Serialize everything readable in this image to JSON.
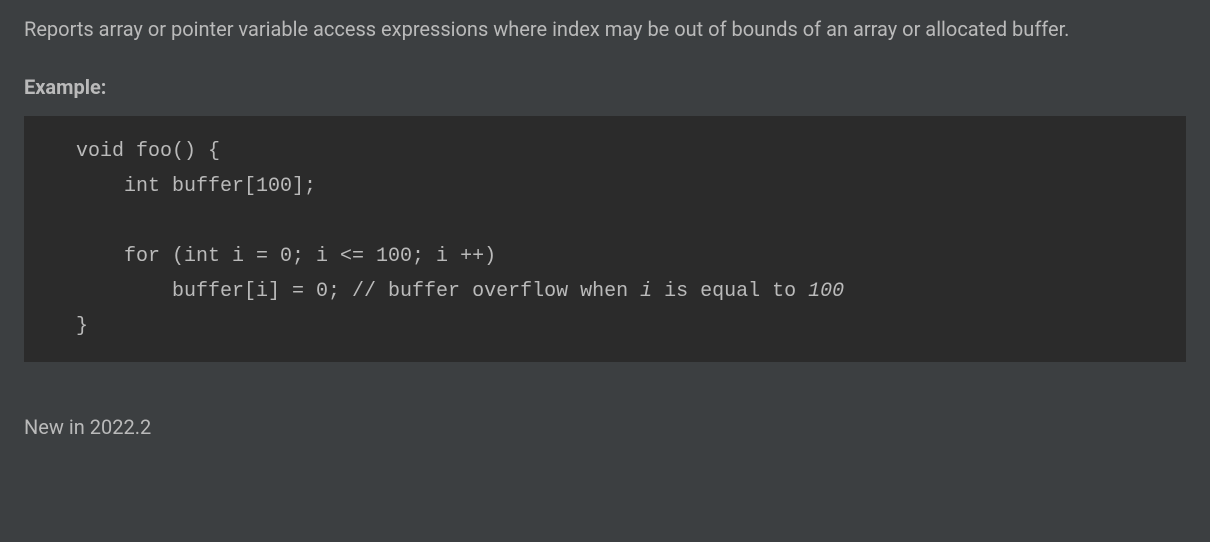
{
  "description": "Reports array or pointer variable access expressions where index may be out of bounds of an array or allocated buffer.",
  "example_heading": "Example:",
  "code": {
    "line1": "void foo() {",
    "line2": "    int buffer[100];",
    "line3": "",
    "line4": "    for (int i = 0; i <= 100; i ++)",
    "line5_pre": "        buffer[i] = 0; // buffer overflow when ",
    "line5_i": "i",
    "line5_mid": " is equal to ",
    "line5_num": "100",
    "line6": "}"
  },
  "version_note": "New in 2022.2"
}
